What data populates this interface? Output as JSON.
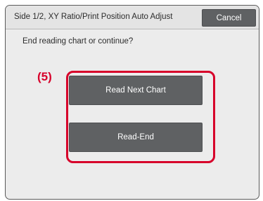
{
  "dialog": {
    "title": "Side 1/2, XY Ratio/Print Position Auto Adjust",
    "cancel_label": "Cancel",
    "prompt": "End reading chart or continue?"
  },
  "annotation": {
    "step_label": "(5)",
    "highlight_color": "#d7002a"
  },
  "actions": {
    "read_next_chart_label": "Read Next Chart",
    "read_end_label": "Read-End"
  },
  "colors": {
    "button_bg": "#5f6163",
    "panel_bg": "#ececec"
  }
}
